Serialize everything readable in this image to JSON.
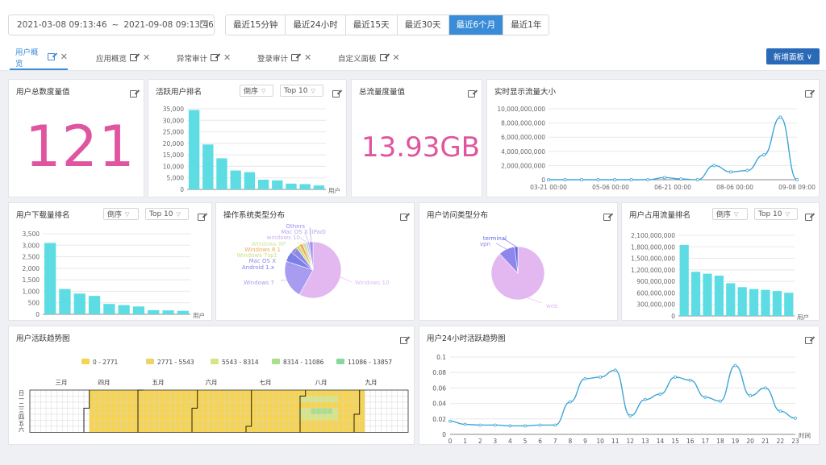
{
  "toolbar": {
    "date_start": "2021-03-08 09:13:46",
    "date_sep": "~",
    "date_end": "2021-09-08 09:13:46",
    "quick_ranges": [
      "最近15分钟",
      "最近24小时",
      "最近15天",
      "最近30天",
      "最近6个月",
      "最近1年"
    ],
    "active_range": "最近6个月"
  },
  "tabs": [
    "用户概览",
    "应用概览",
    "异常审计",
    "登录审计",
    "自定义面板"
  ],
  "active_tab": "用户概览",
  "new_panel_label": "新增面板",
  "colors": {
    "accent": "#3b8cd8",
    "bar": "#5ddde3",
    "bignum": "#e0559f",
    "line": "#3ea5d8",
    "pie_main": "#e3b8f0",
    "pie_secondary": "#9d8fe8"
  },
  "panels": {
    "total_users": {
      "title": "用户总数度量值",
      "value": "121"
    },
    "active_rank": {
      "title": "活跃用户排名",
      "order": "倒序",
      "top": "Top 10"
    },
    "total_traffic": {
      "title": "总流量度量值",
      "value": "13.93GB"
    },
    "realtime_traffic": {
      "title": "实时显示流量大小"
    },
    "download_rank": {
      "title": "用户下载量排名",
      "order": "倒序",
      "top": "Top 10"
    },
    "os_dist": {
      "title": "操作系统类型分布"
    },
    "access_dist": {
      "title": "用户访问类型分布"
    },
    "traffic_rank": {
      "title": "用户占用流量排名",
      "order": "倒序",
      "top": "Top 10"
    },
    "activity_trend": {
      "title": "用户活跃趋势图"
    },
    "activity_24h": {
      "title": "用户24小时活跃趋势图"
    }
  },
  "chart_data": [
    {
      "id": "active_rank",
      "type": "bar",
      "values": [
        34500,
        19500,
        13500,
        8200,
        7500,
        4200,
        3900,
        2500,
        2300,
        1700
      ],
      "yticks": [
        "35,000",
        "30,000",
        "25,000",
        "20,000",
        "15,000",
        "10,000",
        "5,000",
        "0"
      ],
      "ylim": [
        0,
        35000
      ],
      "xlabel": "用户"
    },
    {
      "id": "realtime_traffic",
      "type": "line",
      "x": [
        "03-21 00:00",
        "05-06 00:00",
        "06-21 00:00",
        "08-06 00:00",
        "09-08 09:00"
      ],
      "yticks": [
        "10,000,000,000",
        "8,000,000,000",
        "6,000,000,000",
        "4,000,000,000",
        "2,000,000,000",
        "0"
      ],
      "ylim": [
        0,
        10000000000
      ],
      "values": [
        0,
        0,
        0,
        0,
        0,
        0,
        0,
        300000000,
        100000000,
        0,
        2000000000,
        1100000000,
        1300000000,
        3500000000,
        8800000000,
        0
      ]
    },
    {
      "id": "download_rank",
      "type": "bar",
      "values": [
        3100,
        1100,
        900,
        800,
        450,
        400,
        340,
        180,
        170,
        150
      ],
      "yticks": [
        "3,500",
        "3,000",
        "2,500",
        "2,000",
        "1,500",
        "1,000",
        "500",
        "0"
      ],
      "ylim": [
        0,
        3500
      ],
      "xlabel": "用户"
    },
    {
      "id": "os_dist",
      "type": "pie",
      "labels": [
        "Windows 10",
        "Windows 7",
        "Android 1.x",
        "Mac OS X",
        "Windows 7sp1",
        "Windows 8.1",
        "Windows XP",
        "windows 10",
        "Mac OS X (iPad)",
        "Others"
      ],
      "values": [
        58,
        22,
        6,
        4,
        2,
        2,
        2,
        1,
        1,
        2
      ],
      "colors": [
        "#e3b8f0",
        "#a79cf0",
        "#7b7fe8",
        "#8e86ea",
        "#c6e27a",
        "#f2a85c",
        "#cfe3a0",
        "#c8b3f2",
        "#b6a6ef",
        "#9c90ec"
      ]
    },
    {
      "id": "access_dist",
      "type": "pie",
      "labels": [
        "web",
        "vpn",
        "terminal"
      ],
      "values": [
        88,
        10,
        2
      ],
      "colors": [
        "#e3b8f0",
        "#8e86ea",
        "#5f68e0"
      ]
    },
    {
      "id": "traffic_rank",
      "type": "bar",
      "values": [
        1850000000,
        1150000000,
        1100000000,
        1050000000,
        850000000,
        750000000,
        700000000,
        680000000,
        650000000,
        600000000
      ],
      "yticks": [
        "2,100,000,000",
        "1,800,000,000",
        "1,500,000,000",
        "1,200,000,000",
        "900,000,000",
        "600,000,000",
        "300,000,000",
        "0"
      ],
      "ylim": [
        0,
        2100000000
      ],
      "xlabel": "用户"
    },
    {
      "id": "activity_trend",
      "type": "heatmap",
      "legend": [
        "0 - 2771",
        "2771 - 5543",
        "5543 - 8314",
        "8314 - 11086",
        "11086 - 13857"
      ],
      "legend_colors": [
        "#f6d350",
        "#ead56b",
        "#d6e486",
        "#a9de8a",
        "#86d99c"
      ],
      "months": [
        "三月",
        "四月",
        "五月",
        "六月",
        "七月",
        "八月",
        "九月"
      ],
      "weekdays": [
        "日",
        "一",
        "二",
        "三",
        "四",
        "五",
        "六"
      ]
    },
    {
      "id": "activity_24h",
      "type": "line",
      "x": [
        "0",
        "1",
        "2",
        "3",
        "4",
        "5",
        "6",
        "7",
        "8",
        "9",
        "10",
        "11",
        "12",
        "13",
        "14",
        "15",
        "16",
        "17",
        "18",
        "19",
        "20",
        "21",
        "22",
        "23"
      ],
      "values": [
        0.017,
        0.013,
        0.012,
        0.012,
        0.011,
        0.011,
        0.012,
        0.012,
        0.042,
        0.072,
        0.074,
        0.083,
        0.024,
        0.045,
        0.052,
        0.074,
        0.07,
        0.048,
        0.043,
        0.089,
        0.05,
        0.06,
        0.03,
        0.021
      ],
      "yticks": [
        "0.1",
        "0.08",
        "0.06",
        "0.04",
        "0.02",
        "0"
      ],
      "ylim": [
        0,
        0.1
      ],
      "xlabel": "时间"
    }
  ]
}
